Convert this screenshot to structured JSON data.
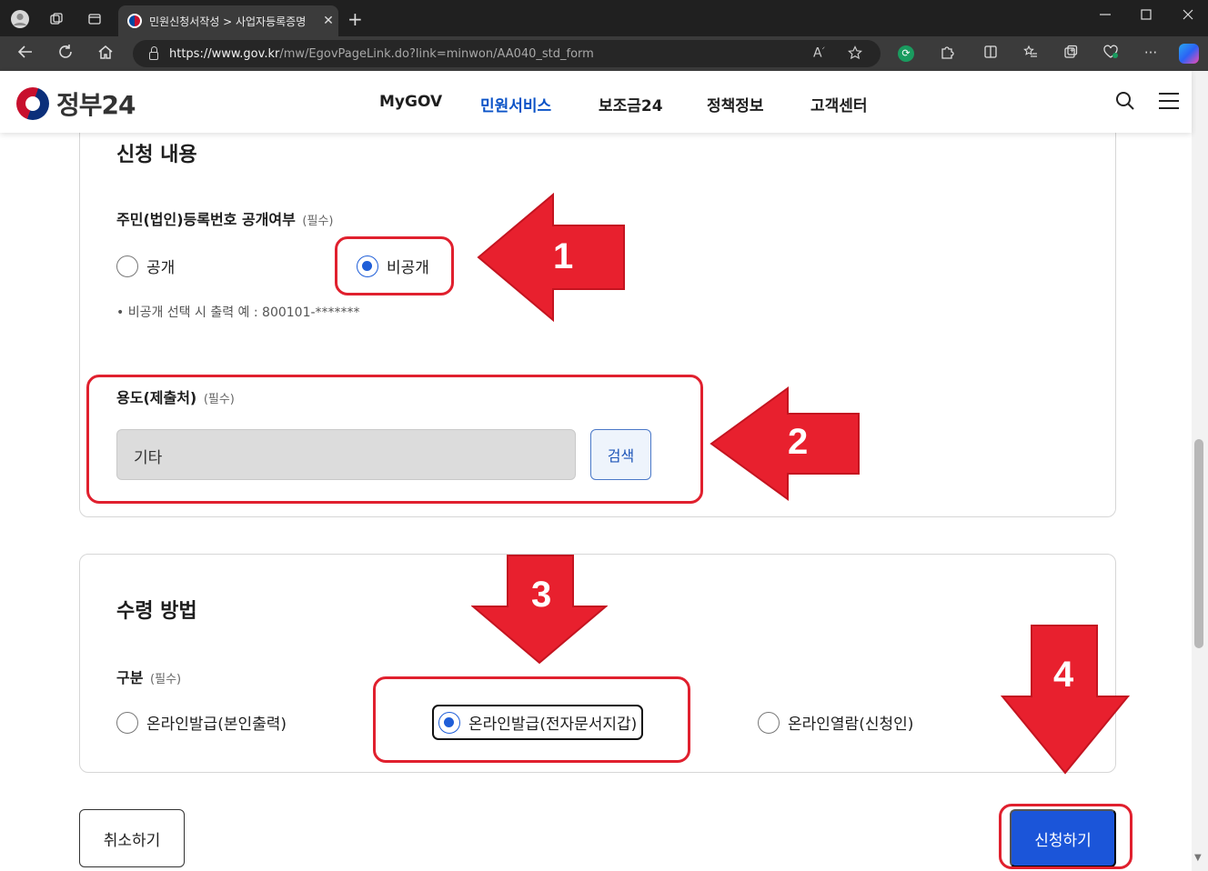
{
  "browser": {
    "tab_title": "민원신청서작성 > 사업자등록증명",
    "tab_close": "✕",
    "new_tab": "+",
    "url_domain": "https://www.gov.kr",
    "url_path": "/mw/EgovPageLink.do?link=minwon/AA040_std_form"
  },
  "header": {
    "logo_text": "정부24",
    "nav": [
      "MyGOV",
      "민원서비스",
      "보조금24",
      "정책정보",
      "고객센터"
    ],
    "active_nav": "민원서비스"
  },
  "section_apply": {
    "title": "신청 내용",
    "id_disclosure": {
      "label": "주민(법인)등록번호 공개여부",
      "required": "(필수)",
      "options": [
        "공개",
        "비공개"
      ],
      "selected": "비공개",
      "hint": "• 비공개 선택 시 출력 예 : 800101-*******"
    },
    "purpose": {
      "label": "용도(제출처)",
      "required": "(필수)",
      "value": "기타",
      "search_button": "검색"
    }
  },
  "section_receive": {
    "title": "수령 방법",
    "method": {
      "label": "구분",
      "required": "(필수)",
      "options": [
        "온라인발급(본인출력)",
        "온라인발급(전자문서지갑)",
        "온라인열람(신청인)"
      ],
      "selected": "온라인발급(전자문서지갑)"
    }
  },
  "actions": {
    "cancel": "취소하기",
    "submit": "신청하기"
  },
  "annotations": {
    "steps": [
      "1",
      "2",
      "3",
      "4"
    ],
    "color": "#e0202e"
  }
}
